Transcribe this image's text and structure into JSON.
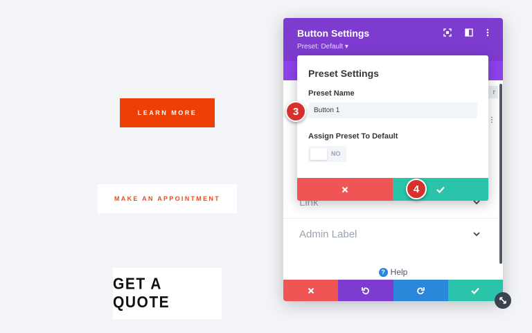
{
  "canvas": {
    "learn_more": "LEARN MORE",
    "make_appointment": "MAKE AN APPOINTMENT",
    "get_quote": "GET A QUOTE"
  },
  "panel": {
    "title": "Button Settings",
    "preset_label": "Preset: Default ▾",
    "filter_peek": "r",
    "sections": [
      {
        "label": "Link"
      },
      {
        "label": "Admin Label"
      }
    ],
    "help": "Help"
  },
  "popup": {
    "title": "Preset Settings",
    "name_label": "Preset Name",
    "name_value": "Button 1",
    "assign_label": "Assign Preset To Default",
    "toggle_text": "NO"
  },
  "badges": {
    "step3": "3",
    "step4": "4"
  },
  "colors": {
    "header_purple": "#7e3bd0",
    "tab_purple": "#8f42ec",
    "cancel_red": "#ef5555",
    "confirm_green": "#29c4a9",
    "undo_purple": "#7e3bd0",
    "redo_blue": "#2b87da",
    "badge_red": "#d5322e"
  },
  "icons": {
    "header": [
      "fullscreen-icon",
      "split-view-icon",
      "more-options-icon"
    ],
    "footer": [
      "close-icon",
      "undo-icon",
      "redo-icon",
      "check-icon"
    ],
    "popup_actions": [
      "close-icon",
      "check-icon"
    ],
    "help": "question-icon",
    "resize": "resize-icon"
  }
}
